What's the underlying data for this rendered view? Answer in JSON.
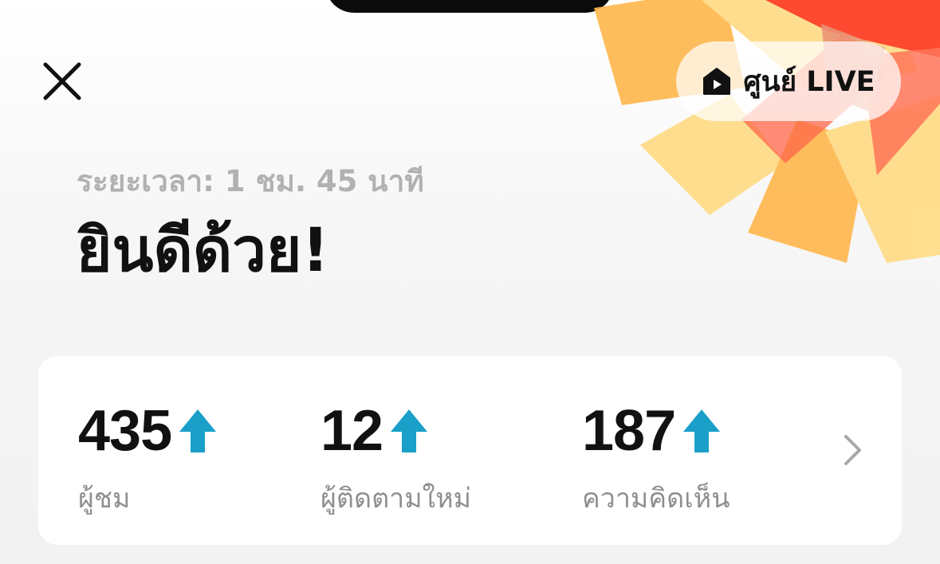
{
  "header": {
    "close_icon": "close-icon",
    "live_center_icon": "live-house-icon",
    "live_center_label": "ศูนย์ LIVE"
  },
  "summary": {
    "duration_text": "ระยะเวลา: 1 ชม. 45 นาที",
    "headline": "ยินดีด้วย!"
  },
  "stats": {
    "items": [
      {
        "value": "435",
        "label": "ผู้ชม",
        "trend": "up"
      },
      {
        "value": "12",
        "label": "ผู้ติดตามใหม่",
        "trend": "up"
      },
      {
        "value": "187",
        "label": "ความคิดเห็น",
        "trend": "up"
      }
    ],
    "trend_icon": "arrow-up-icon",
    "chevron_icon": "chevron-right-icon"
  },
  "colors": {
    "trend_up": "#1a9fc9",
    "burst_red": "#ff3b1f",
    "burst_orange": "#ffb84f",
    "burst_yellow": "#ffdb86",
    "muted_text": "#b1b1b1"
  }
}
